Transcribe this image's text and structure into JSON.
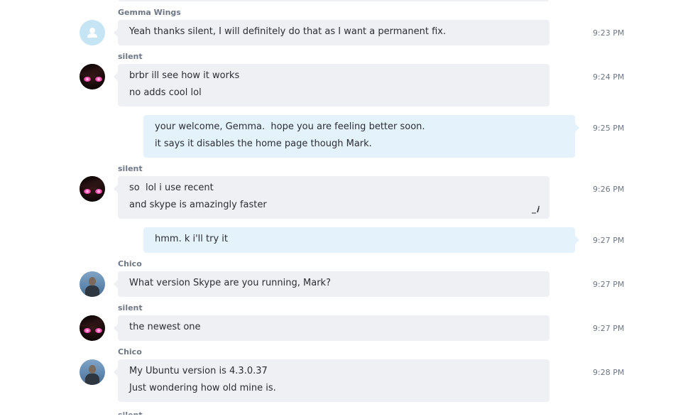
{
  "conversation": {
    "messages": [
      {
        "sender": "Gemma Wings",
        "avatar": "default-avatar",
        "direction": "incoming",
        "lines": [
          "Yeah thanks silent, I will definitely do that as I want a permanent fix."
        ],
        "time": "9:23 PM"
      },
      {
        "sender": "silent",
        "avatar": "silent-avatar",
        "direction": "incoming",
        "lines": [
          "brbr ill see how it works",
          "no adds cool lol"
        ],
        "time": "9:24 PM"
      },
      {
        "sender": "",
        "direction": "outgoing",
        "lines": [
          "your welcome, Gemma.  hope you are feeling better soon.",
          "it says it disables the home page though Mark."
        ],
        "time": "9:25 PM"
      },
      {
        "sender": "silent",
        "avatar": "silent-avatar",
        "direction": "incoming",
        "lines": [
          "so  lol i use recent",
          "and skype is amazingly faster"
        ],
        "time": "9:26 PM",
        "edited_icon": "edit-pencil-icon"
      },
      {
        "sender": "",
        "direction": "outgoing",
        "lines": [
          "hmm. k i'll try it"
        ],
        "time": "9:27 PM"
      },
      {
        "sender": "Chico",
        "avatar": "chico-avatar",
        "direction": "incoming",
        "lines": [
          "What version Skype are you running, Mark?"
        ],
        "time": "9:27 PM"
      },
      {
        "sender": "silent",
        "avatar": "silent-avatar",
        "direction": "incoming",
        "lines": [
          "the newest one"
        ],
        "time": "9:27 PM"
      },
      {
        "sender": "Chico",
        "avatar": "chico-avatar",
        "direction": "incoming",
        "lines": [
          "My Ubuntu version is 4.3.0.37",
          "Just wondering how old mine is."
        ],
        "time": "9:28 PM"
      }
    ],
    "cut_off_sender": "silent"
  },
  "colors": {
    "incoming_bubble": "#eef0f4",
    "outgoing_bubble": "#e4f3fb",
    "sender_text": "#6d7785",
    "message_text": "#2a2d33"
  }
}
